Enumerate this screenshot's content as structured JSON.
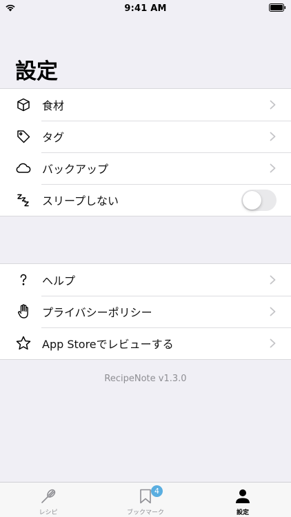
{
  "status_bar": {
    "time": "9:41 AM"
  },
  "page_title": "設定",
  "settings_group_1": [
    {
      "label": "食材",
      "icon": "cube-icon"
    },
    {
      "label": "タグ",
      "icon": "tag-icon"
    },
    {
      "label": "バックアップ",
      "icon": "cloud-icon"
    },
    {
      "label": "スリープしない",
      "icon": "sleep-icon",
      "toggle_on": false
    }
  ],
  "settings_group_2": [
    {
      "label": "ヘルプ",
      "icon": "question-icon"
    },
    {
      "label": "プライバシーポリシー",
      "icon": "hand-icon"
    },
    {
      "label": "App Storeでレビューする",
      "icon": "star-icon"
    }
  ],
  "version_text": "RecipeNote v1.3.0",
  "tab_bar": {
    "tabs": [
      {
        "label": "レシピ",
        "icon": "whisk-icon"
      },
      {
        "label": "ブックマーク",
        "icon": "bookmark-icon",
        "badge": "4"
      },
      {
        "label": "設定",
        "icon": "person-icon",
        "active": true
      }
    ]
  },
  "colors": {
    "background": "#f0eff5",
    "badge": "#5aaee0",
    "secondary_text": "#8e8e93"
  }
}
